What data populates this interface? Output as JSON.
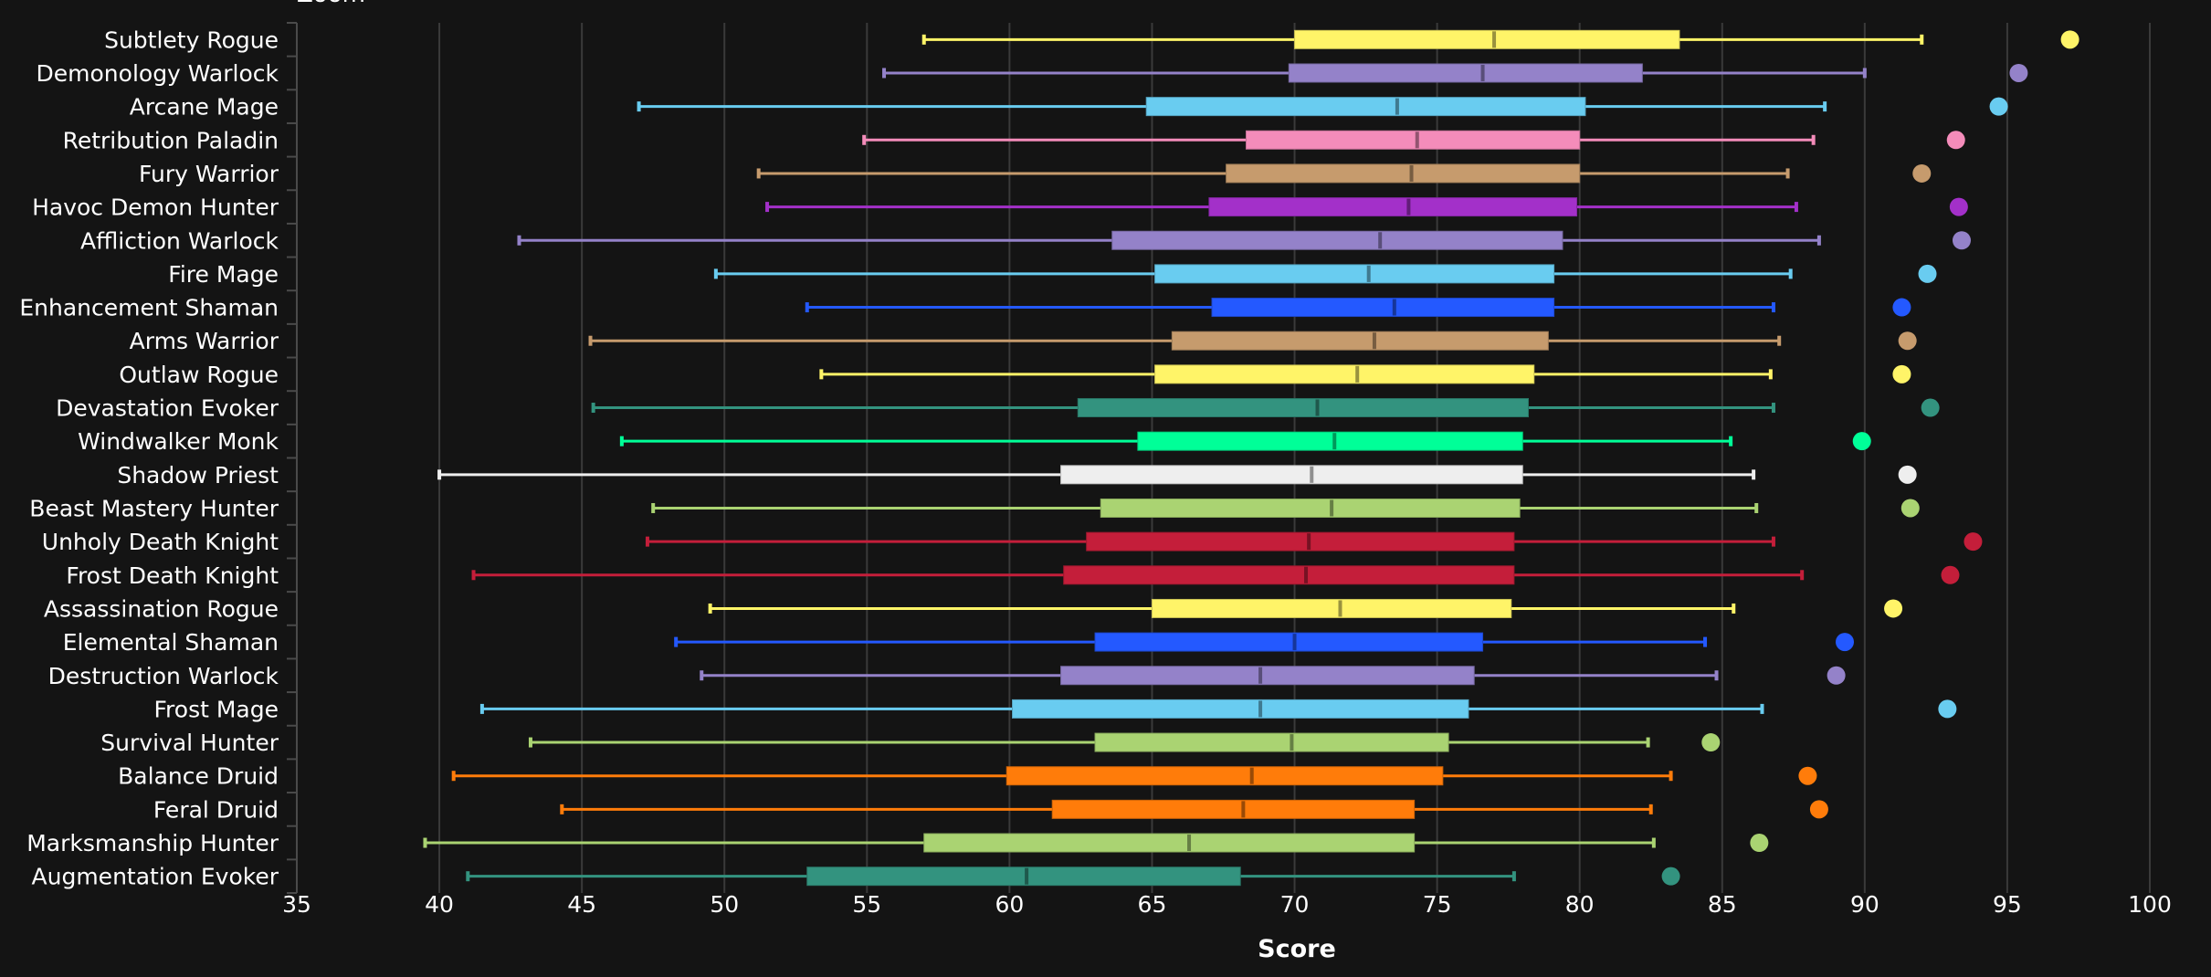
{
  "chart_data": {
    "type": "boxplot",
    "orientation": "horizontal",
    "title": "",
    "clipped_top_text": "Zoom",
    "xlabel": "Score",
    "ylabel": "",
    "xlim": [
      35,
      100
    ],
    "xticks": [
      35,
      40,
      45,
      50,
      55,
      60,
      65,
      70,
      75,
      80,
      85,
      90,
      95,
      100
    ],
    "grid": "vertical",
    "background": "#141414",
    "series": [
      {
        "name": "Subtlety Rogue",
        "color": "#FFF468",
        "min": 57.0,
        "q1": 70.0,
        "median": 77.0,
        "q3": 83.5,
        "max": 92.0,
        "outlier": 97.2
      },
      {
        "name": "Demonology Warlock",
        "color": "#9482C9",
        "min": 55.6,
        "q1": 69.8,
        "median": 76.6,
        "q3": 82.2,
        "max": 90.0,
        "outlier": 95.4
      },
      {
        "name": "Arcane Mage",
        "color": "#69CCF0",
        "min": 47.0,
        "q1": 64.8,
        "median": 73.6,
        "q3": 80.2,
        "max": 88.6,
        "outlier": 94.7
      },
      {
        "name": "Retribution Paladin",
        "color": "#F48CBA",
        "min": 54.9,
        "q1": 68.3,
        "median": 74.3,
        "q3": 80.0,
        "max": 88.2,
        "outlier": 93.2
      },
      {
        "name": "Fury Warrior",
        "color": "#C69B6D",
        "min": 51.2,
        "q1": 67.6,
        "median": 74.1,
        "q3": 80.0,
        "max": 87.3,
        "outlier": 92.0
      },
      {
        "name": "Havoc Demon Hunter",
        "color": "#A330C9",
        "min": 51.5,
        "q1": 67.0,
        "median": 74.0,
        "q3": 79.9,
        "max": 87.6,
        "outlier": 93.3
      },
      {
        "name": "Affliction Warlock",
        "color": "#9482C9",
        "min": 42.8,
        "q1": 63.6,
        "median": 73.0,
        "q3": 79.4,
        "max": 88.4,
        "outlier": 93.4
      },
      {
        "name": "Fire Mage",
        "color": "#69CCF0",
        "min": 49.7,
        "q1": 65.1,
        "median": 72.6,
        "q3": 79.1,
        "max": 87.4,
        "outlier": 92.2
      },
      {
        "name": "Enhancement Shaman",
        "color": "#2459FF",
        "min": 52.9,
        "q1": 67.1,
        "median": 73.5,
        "q3": 79.1,
        "max": 86.8,
        "outlier": 91.3
      },
      {
        "name": "Arms Warrior",
        "color": "#C69B6D",
        "min": 45.3,
        "q1": 65.7,
        "median": 72.8,
        "q3": 78.9,
        "max": 87.0,
        "outlier": 91.5
      },
      {
        "name": "Outlaw Rogue",
        "color": "#FFF468",
        "min": 53.4,
        "q1": 65.1,
        "median": 72.2,
        "q3": 78.4,
        "max": 86.7,
        "outlier": 91.3
      },
      {
        "name": "Devastation Evoker",
        "color": "#33937F",
        "min": 45.4,
        "q1": 62.4,
        "median": 70.8,
        "q3": 78.2,
        "max": 86.8,
        "outlier": 92.3
      },
      {
        "name": "Windwalker Monk",
        "color": "#00FF98",
        "min": 46.4,
        "q1": 64.5,
        "median": 71.4,
        "q3": 78.0,
        "max": 85.3,
        "outlier": 89.9
      },
      {
        "name": "Shadow Priest",
        "color": "#EEEEEE",
        "min": 40.0,
        "q1": 61.8,
        "median": 70.6,
        "q3": 78.0,
        "max": 86.1,
        "outlier": 91.5
      },
      {
        "name": "Beast Mastery Hunter",
        "color": "#AAD372",
        "min": 47.5,
        "q1": 63.2,
        "median": 71.3,
        "q3": 77.9,
        "max": 86.2,
        "outlier": 91.6
      },
      {
        "name": "Unholy Death Knight",
        "color": "#C41E3A",
        "min": 47.3,
        "q1": 62.7,
        "median": 70.5,
        "q3": 77.7,
        "max": 86.8,
        "outlier": 93.8
      },
      {
        "name": "Frost Death Knight",
        "color": "#C41E3A",
        "min": 41.2,
        "q1": 61.9,
        "median": 70.4,
        "q3": 77.7,
        "max": 87.8,
        "outlier": 93.0
      },
      {
        "name": "Assassination Rogue",
        "color": "#FFF468",
        "min": 49.5,
        "q1": 65.0,
        "median": 71.6,
        "q3": 77.6,
        "max": 85.4,
        "outlier": 91.0
      },
      {
        "name": "Elemental Shaman",
        "color": "#2459FF",
        "min": 48.3,
        "q1": 63.0,
        "median": 70.0,
        "q3": 76.6,
        "max": 84.4,
        "outlier": 89.3
      },
      {
        "name": "Destruction Warlock",
        "color": "#9482C9",
        "min": 49.2,
        "q1": 61.8,
        "median": 68.8,
        "q3": 76.3,
        "max": 84.8,
        "outlier": 89.0
      },
      {
        "name": "Frost Mage",
        "color": "#69CCF0",
        "min": 41.5,
        "q1": 60.1,
        "median": 68.8,
        "q3": 76.1,
        "max": 86.4,
        "outlier": 92.9
      },
      {
        "name": "Survival Hunter",
        "color": "#AAD372",
        "min": 43.2,
        "q1": 63.0,
        "median": 69.9,
        "q3": 75.4,
        "max": 82.4,
        "outlier": 84.6
      },
      {
        "name": "Balance Druid",
        "color": "#FF7C0A",
        "min": 40.5,
        "q1": 59.9,
        "median": 68.5,
        "q3": 75.2,
        "max": 83.2,
        "outlier": 88.0
      },
      {
        "name": "Feral Druid",
        "color": "#FF7C0A",
        "min": 44.3,
        "q1": 61.5,
        "median": 68.2,
        "q3": 74.2,
        "max": 82.5,
        "outlier": 88.4
      },
      {
        "name": "Marksmanship Hunter",
        "color": "#AAD372",
        "min": 39.5,
        "q1": 57.0,
        "median": 66.3,
        "q3": 74.2,
        "max": 82.6,
        "outlier": 86.3
      },
      {
        "name": "Augmentation Evoker",
        "color": "#33937F",
        "min": 41.0,
        "q1": 52.9,
        "median": 60.6,
        "q3": 68.1,
        "max": 77.7,
        "outlier": 83.2
      }
    ]
  }
}
